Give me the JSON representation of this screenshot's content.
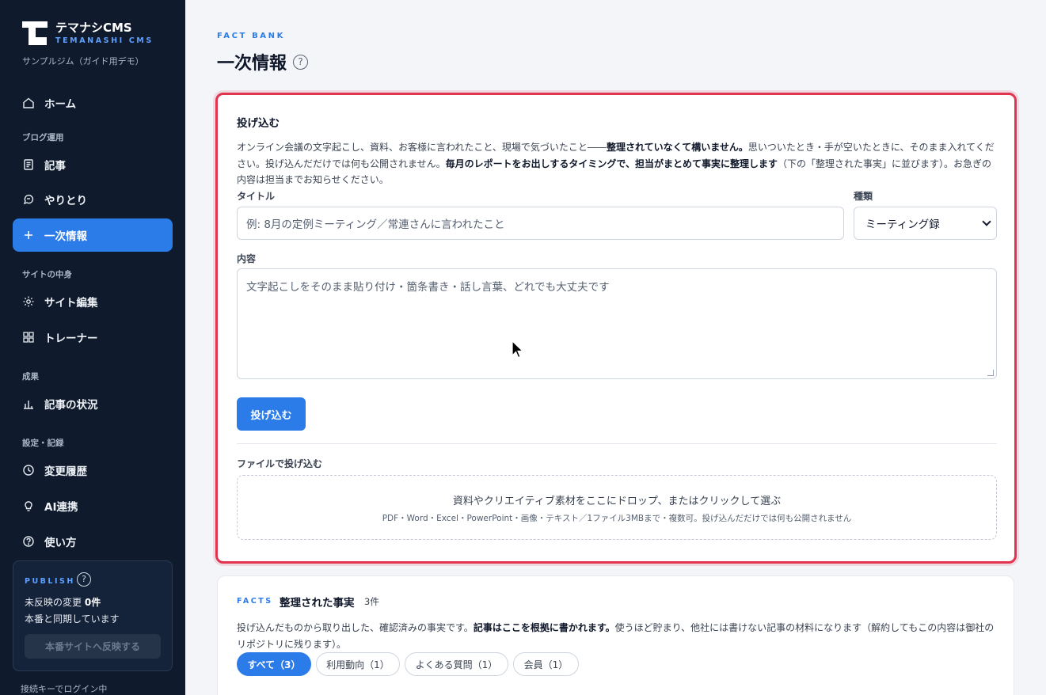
{
  "sidebar": {
    "brand_name": "テマナシCMS",
    "brand_sub": "TEMANASHI CMS",
    "org_name": "サンプルジム（ガイド用デモ）",
    "items": [
      {
        "label": "ホーム",
        "icon": "home-icon"
      },
      {
        "label": "記事",
        "icon": "document-icon"
      },
      {
        "label": "やりとり",
        "icon": "chat-icon"
      },
      {
        "label": "一次情報",
        "icon": "plus-icon",
        "active": true
      },
      {
        "label": "サイト編集",
        "icon": "gear-icon"
      },
      {
        "label": "トレーナー",
        "icon": "grid-icon"
      },
      {
        "label": "記事の状況",
        "icon": "bar-chart-icon"
      },
      {
        "label": "変更履歴",
        "icon": "clock-icon"
      },
      {
        "label": "AI連携",
        "icon": "bulb-icon"
      },
      {
        "label": "使い方",
        "icon": "help-icon"
      }
    ],
    "sections": [
      "ブログ運用",
      "サイトの中身",
      "成果",
      "設定・記録"
    ],
    "publish": {
      "heading": "PUBLISH",
      "help": "?",
      "pending_prefix": "未反映の変更",
      "pending_count": "0件",
      "sync_status": "本番と同期しています",
      "button_label": "本番サイトへ反映する"
    },
    "login_status": "接続キーでログイン中"
  },
  "header": {
    "eyebrow": "FACT BANK",
    "title": "一次情報",
    "help": "?"
  },
  "intake": {
    "title": "投げ込む",
    "desc_1": "オンライン会議の文字起こし、資料、お客様に言われたこと、現場で気づいたこと――",
    "desc_b1": "整理されていなくて構いません。",
    "desc_2": "思いついたとき・手が空いたときに、そのまま入れてください。投げ込んだだけでは何も公開されません。",
    "desc_b2": "毎月のレポートをお出しするタイミングで、担当がまとめて事実に整理します",
    "desc_3": "（下の「整理された事実」に並びます）。お急ぎの内容は担当までお知らせください。",
    "title_label": "タイトル",
    "title_placeholder": "例: 8月の定例ミーティング／常連さんに言われたこと",
    "kind_label": "種類",
    "kind_value": "ミーティング録",
    "content_label": "内容",
    "content_placeholder": "文字起こしをそのまま貼り付け・箇条書き・話し言葉、どれでも大丈夫です",
    "submit_label": "投げ込む",
    "file_label": "ファイルで投げ込む",
    "dropzone_main": "資料やクリエイティブ素材をここにドロップ、またはクリックして選ぶ",
    "dropzone_sub": "PDF・Word・Excel・PowerPoint・画像・テキスト／1ファイル3MBまで・複数可。投げ込んだだけでは何も公開されません"
  },
  "facts": {
    "eyebrow": "FACTS",
    "title": "整理された事実",
    "count": "3件",
    "desc_1": "投げ込んだものから取り出した、確認済みの事実です。",
    "desc_b": "記事はここを根拠に書かれます。",
    "desc_2": "使うほど貯まり、他社には書けない記事の材料になります（解約してもこの内容は御社のリポジトリに残ります）。",
    "filters": [
      "すべて（3）",
      "利用動向（1）",
      "よくある質問（1）",
      "会員（1）"
    ]
  },
  "colors": {
    "accent": "#2b7be8",
    "sidebar_bg": "#0f1b2d",
    "highlight_border": "#e0354f"
  }
}
